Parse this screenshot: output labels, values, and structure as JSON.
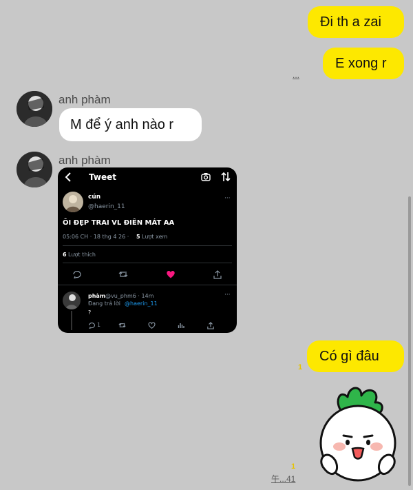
{
  "messages_out": [
    {
      "text": "Đi th a zai"
    },
    {
      "text": "E xong r"
    },
    {
      "text": "Có gì đâu"
    }
  ],
  "read_meta_1": "...",
  "unread_marker_1": "1",
  "unread_marker_2": "1",
  "last_time": "午...41",
  "sender_name": "anh phàm",
  "message_in": "M để ý anh nào r",
  "tweet": {
    "header_title": "Tweet",
    "author_name": "cún",
    "author_handle": "@haerin_11",
    "body": "ÔI ĐẸP TRAI VL ĐIÊN MÁT AA",
    "time": "05:06 CH · 18 thg 4 26 ·",
    "views_count": "5",
    "views_label": "Lượt xem",
    "likes_count": "6",
    "likes_label": "Lượt thích",
    "reply_name": "phàm",
    "reply_handle": "@vu_phm6 · 14m",
    "reply_to_prefix": "Đang trả lời",
    "reply_to_handle": "@haerin_11",
    "reply_text": "?",
    "reply_comment_count": "1",
    "more": "···"
  },
  "colors": {
    "outgoing": "#fde800",
    "incoming": "#ffffff",
    "background": "#c8c8c8",
    "like": "#f91880",
    "link": "#1d9bf0"
  }
}
